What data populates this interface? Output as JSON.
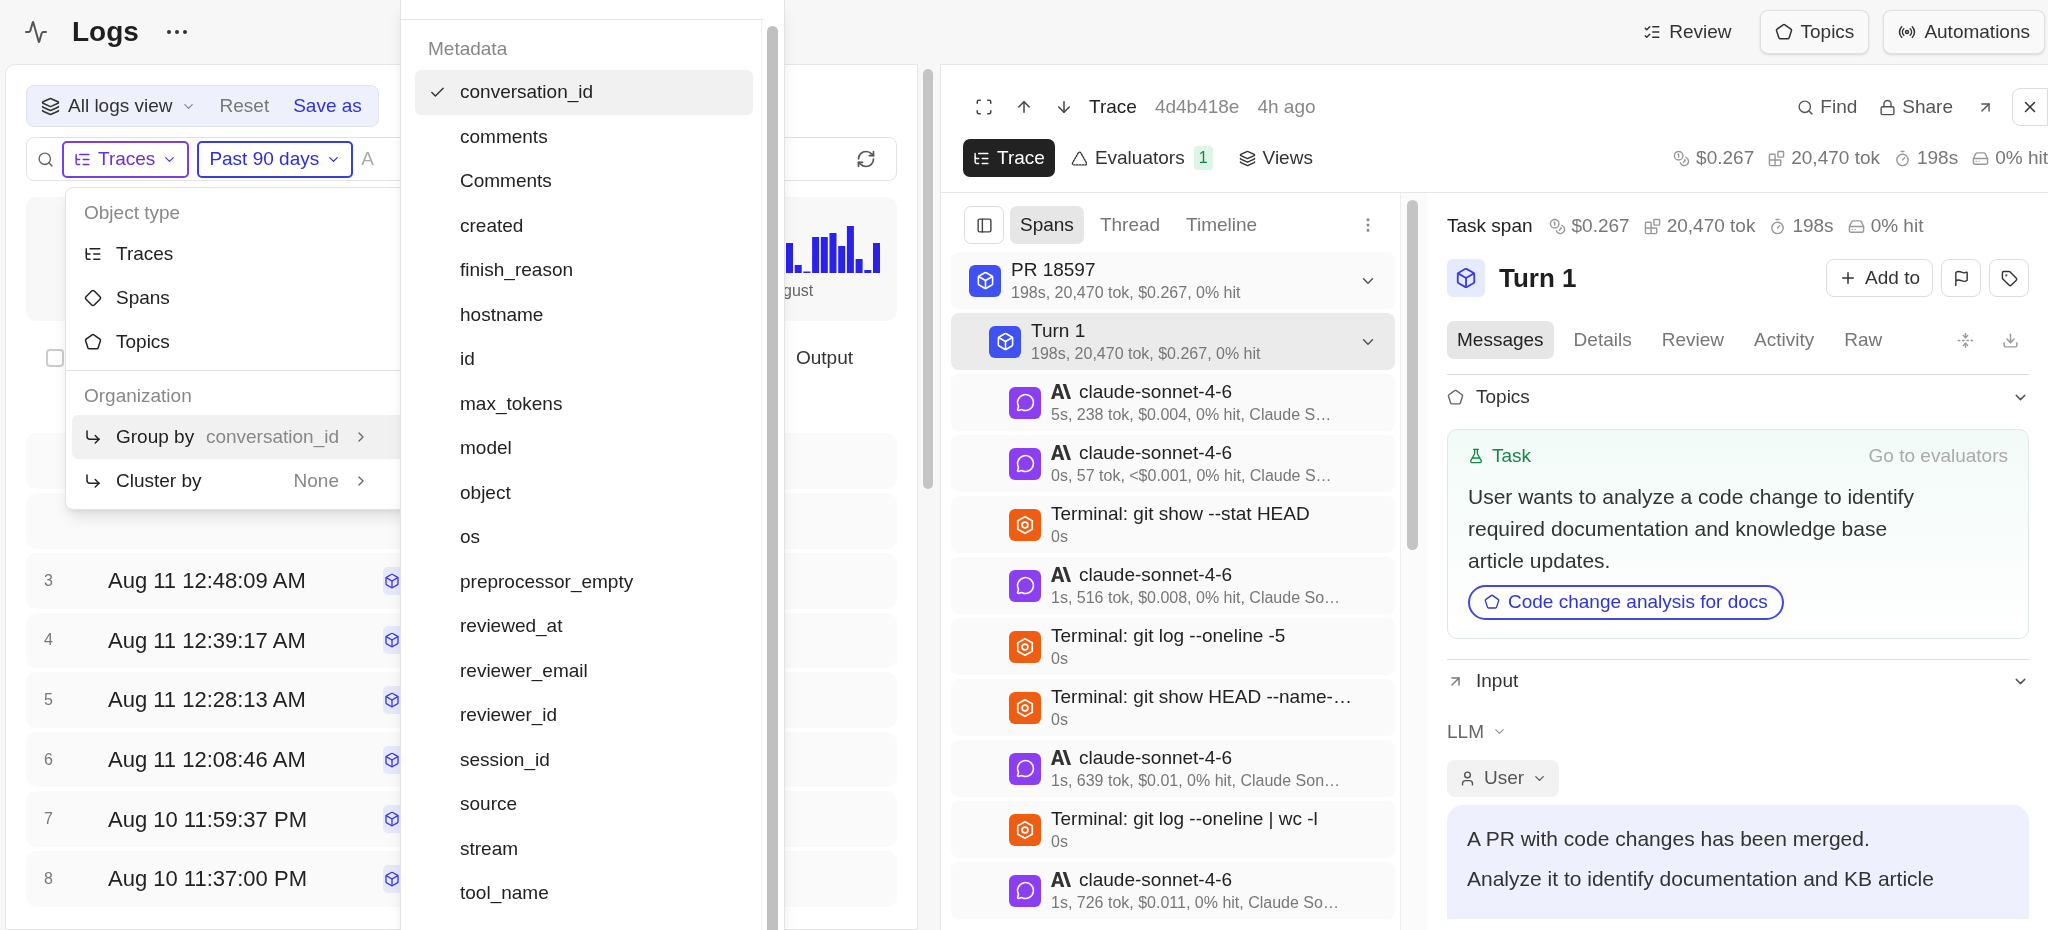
{
  "header": {
    "title": "Logs",
    "actions": [
      {
        "kind": "plain",
        "label": "Review"
      },
      {
        "kind": "outlined",
        "label": "Topics"
      },
      {
        "kind": "outlined",
        "label": "Automations"
      }
    ]
  },
  "view_bar": {
    "view": "All logs view",
    "reset": "Reset",
    "save": "Save as"
  },
  "filter_bar": {
    "chips": [
      {
        "kind": "type",
        "label": "Traces"
      },
      {
        "kind": "range",
        "label": "Past 90 days"
      }
    ],
    "fragment": "A"
  },
  "histogram": {
    "axis_label": "gust"
  },
  "table": {
    "select_all_checked": false,
    "column_header": "Output",
    "rows": [
      {
        "index": "3",
        "time": "Aug 11 12:48:09 AM"
      },
      {
        "index": "4",
        "time": "Aug 11 12:39:17 AM"
      },
      {
        "index": "5",
        "time": "Aug 11 12:28:13 AM"
      },
      {
        "index": "6",
        "time": "Aug 11 12:08:46 AM"
      },
      {
        "index": "7",
        "time": "Aug 10 11:59:37 PM"
      },
      {
        "index": "8",
        "time": "Aug 10 11:37:00 PM"
      }
    ]
  },
  "object_menu": {
    "type_heading": "Object type",
    "types": [
      {
        "label": "Traces"
      },
      {
        "label": "Spans"
      },
      {
        "label": "Topics"
      }
    ],
    "organization_heading": "Organization",
    "organization": [
      {
        "label": "Group by",
        "value": "conversation_id",
        "highlighted": true
      },
      {
        "label": "Cluster by",
        "value": "None",
        "highlighted": false
      }
    ]
  },
  "metadata_menu": {
    "heading": "Metadata",
    "items": [
      {
        "label": "conversation_id",
        "checked": true
      },
      {
        "label": "comments",
        "checked": false
      },
      {
        "label": "Comments",
        "checked": false
      },
      {
        "label": "created",
        "checked": false
      },
      {
        "label": "finish_reason",
        "checked": false
      },
      {
        "label": "hostname",
        "checked": false
      },
      {
        "label": "id",
        "checked": false
      },
      {
        "label": "max_tokens",
        "checked": false
      },
      {
        "label": "model",
        "checked": false
      },
      {
        "label": "object",
        "checked": false
      },
      {
        "label": "os",
        "checked": false
      },
      {
        "label": "preprocessor_empty",
        "checked": false
      },
      {
        "label": "reviewed_at",
        "checked": false
      },
      {
        "label": "reviewer_email",
        "checked": false
      },
      {
        "label": "reviewer_id",
        "checked": false
      },
      {
        "label": "session_id",
        "checked": false
      },
      {
        "label": "source",
        "checked": false
      },
      {
        "label": "stream",
        "checked": false
      },
      {
        "label": "tool_name",
        "checked": false
      }
    ]
  },
  "trace": {
    "title": "Trace",
    "id": "4d4b418e",
    "age": "4h ago",
    "find": "Find",
    "share": "Share",
    "tabs": [
      {
        "label": "Trace",
        "selected": true
      },
      {
        "label": "Evaluators",
        "badge": "1",
        "selected": false
      },
      {
        "label": "Views",
        "selected": false
      }
    ],
    "stats": [
      "$0.267",
      "20,470 tok",
      "198s",
      "0% hit"
    ]
  },
  "spans": {
    "tabs": [
      {
        "label": "Spans",
        "selected": true
      },
      {
        "label": "Thread",
        "selected": false
      },
      {
        "label": "Timeline",
        "selected": false
      }
    ],
    "tree": [
      {
        "kind": "task",
        "name": "PR 18597",
        "meta": "198s, 20,470 tok, $0.267, 0% hit",
        "selected": false,
        "expanded": true,
        "children": [
          {
            "kind": "task",
            "name": "Turn 1",
            "meta": "198s, 20,470 tok, $0.267, 0% hit",
            "selected": true,
            "expanded": true,
            "children": [
              {
                "kind": "llm",
                "name": "claude-sonnet-4-6",
                "meta": "5s, 238 tok, $0.004, 0% hit, Claude S…",
                "selected": false
              },
              {
                "kind": "llm",
                "name": "claude-sonnet-4-6",
                "meta": "0s, 57 tok, <$0.001, 0% hit, Claude S…",
                "selected": false
              },
              {
                "kind": "tool",
                "name": "Terminal: git show --stat HEAD",
                "meta": "0s",
                "selected": false
              },
              {
                "kind": "llm",
                "name": "claude-sonnet-4-6",
                "meta": "1s, 516 tok, $0.008, 0% hit, Claude So…",
                "selected": false
              },
              {
                "kind": "tool",
                "name": "Terminal: git log --oneline -5",
                "meta": "0s",
                "selected": false
              },
              {
                "kind": "tool",
                "name": "Terminal: git show HEAD --name-…",
                "meta": "0s",
                "selected": false
              },
              {
                "kind": "llm",
                "name": "claude-sonnet-4-6",
                "meta": "1s, 639 tok, $0.01, 0% hit, Claude Son…",
                "selected": false
              },
              {
                "kind": "tool",
                "name": "Terminal: git log --oneline | wc -l",
                "meta": "0s",
                "selected": false
              },
              {
                "kind": "llm",
                "name": "claude-sonnet-4-6",
                "meta": "1s, 726 tok, $0.011, 0% hit, Claude So…",
                "selected": false
              }
            ]
          }
        ]
      }
    ]
  },
  "detail": {
    "label": "Task span",
    "stats": [
      "$0.267",
      "20,470 tok",
      "198s",
      "0% hit"
    ],
    "title": "Turn 1",
    "add": "Add to",
    "tabs": [
      {
        "label": "Messages",
        "selected": true
      },
      {
        "label": "Details",
        "selected": false
      },
      {
        "label": "Review",
        "selected": false
      },
      {
        "label": "Activity",
        "selected": false
      },
      {
        "label": "Raw",
        "selected": false
      }
    ],
    "topics": {
      "title": "Topics",
      "expanded": true
    },
    "task_card": {
      "label": "Task",
      "link": "Go to evaluators",
      "text": "User wants to analyze a code change to identify required documentation and knowledge base article updates.",
      "topic": "Code change analysis for docs"
    },
    "input": {
      "title": "Input",
      "expanded": true
    },
    "format": "LLM",
    "role": "User",
    "message_lines": [
      "A PR with code changes has been merged.",
      "Analyze it to identify documentation and KB article"
    ]
  }
}
